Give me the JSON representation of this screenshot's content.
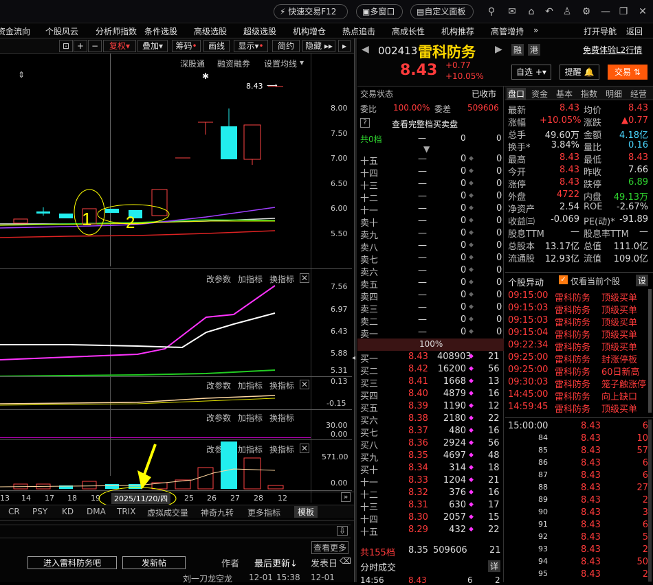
{
  "titlebar": {
    "quick_trade": "快速交易F12",
    "multi_window": "多窗口",
    "custom_panel": "自定义面板"
  },
  "menu": [
    "资金流向",
    "个股风云",
    "分析师指数",
    "条件选股",
    "高级选股",
    "超级选股",
    "机构增仓",
    "热点追击",
    "高成长性",
    "机构推荐",
    "高管增持",
    "»",
    "打开导航",
    "返回"
  ],
  "toolbar": {
    "fuquan": "复权",
    "overlay": "叠加",
    "chips": "筹码",
    "draw": "画线",
    "display": "显示",
    "simple": "简约",
    "hide": "隐藏"
  },
  "chart_top": {
    "links": [
      "深股通",
      "融资融券",
      "设置均线"
    ],
    "price_label": "8.43",
    "yaxis": [
      "8.00",
      "7.50",
      "7.00",
      "6.50",
      "6.00",
      "5.50"
    ]
  },
  "panel2": {
    "btns": [
      "改参数",
      "加指标",
      "换指标"
    ],
    "yaxis": [
      "7.56",
      "6.97",
      "6.43",
      "5.88",
      "5.31"
    ]
  },
  "panel3": {
    "btns": [
      "改参数",
      "加指标",
      "换指标"
    ],
    "yaxis": [
      "0.13",
      "-0.15"
    ]
  },
  "panel4": {
    "btns": [
      "改参数",
      "加指标",
      "换指标"
    ],
    "yaxis": [
      "30.00",
      "0.00"
    ]
  },
  "panel5": {
    "btns": [
      "改参数",
      "加指标",
      "换指标"
    ],
    "yaxis": [
      "571.00",
      "0.00"
    ]
  },
  "xaxis": [
    "13",
    "14",
    "17",
    "18",
    "19",
    "2025/11/20/四",
    "25",
    "26",
    "27",
    "28",
    "12"
  ],
  "annotations": {
    "mark1": "1",
    "mark2": "2"
  },
  "indicator_tabs": [
    "CR",
    "PSY",
    "KD",
    "DMA",
    "TRIX",
    "虚拟成交量",
    "神奇九转",
    "更多指标",
    "模板"
  ],
  "bottom": {
    "check_more": "查看更多",
    "enter_bar": "进入雷科防务吧",
    "post": "发新帖",
    "author": "作者",
    "last_update": "最后更新↓",
    "post_date": "发表日",
    "row_author": "刘一刀龙空龙",
    "row_date1": "12-01",
    "row_time": "15:38",
    "row_date2": "12-01"
  },
  "stock": {
    "code": "002413",
    "name": "雷科防务",
    "price": "8.43",
    "change": "+0.77",
    "pct": "+10.05%",
    "tag1": "融",
    "tag2": "港",
    "l2": "免费体验L2行情",
    "btn_watch": "自选",
    "btn_alert": "提醒",
    "btn_trade": "交易"
  },
  "orderbook": {
    "status_label": "交易状态",
    "status_value": "已收市",
    "weibi_label": "委比",
    "weibi_value": "100.00%",
    "weicha_label": "委差",
    "weicha_value": "509606",
    "full_label": "查看完整档买卖盘",
    "total_sell": "共0档",
    "total_sell_a": "—",
    "total_sell_b": "0",
    "total_sell_c": "0",
    "sell": [
      [
        "十五",
        "—",
        "0",
        "0"
      ],
      [
        "十四",
        "—",
        "0",
        "0"
      ],
      [
        "十三",
        "—",
        "0",
        "0"
      ],
      [
        "十二",
        "—",
        "0",
        "0"
      ],
      [
        "十一",
        "—",
        "0",
        "0"
      ],
      [
        "卖十",
        "—",
        "0",
        "0"
      ],
      [
        "卖九",
        "—",
        "0",
        "0"
      ],
      [
        "卖八",
        "—",
        "0",
        "0"
      ],
      [
        "卖七",
        "—",
        "0",
        "0"
      ],
      [
        "卖六",
        "—",
        "0",
        "0"
      ],
      [
        "卖五",
        "—",
        "0",
        "0"
      ],
      [
        "卖四",
        "—",
        "0",
        "0"
      ],
      [
        "卖三",
        "—",
        "0",
        "0"
      ],
      [
        "卖二",
        "—",
        "0",
        "0"
      ],
      [
        "卖一",
        "—",
        "0",
        "0"
      ]
    ],
    "ratio": "100%",
    "buy": [
      [
        "买一",
        "8.43",
        "408903",
        "21"
      ],
      [
        "买二",
        "8.42",
        "16200",
        "56"
      ],
      [
        "买三",
        "8.41",
        "1668",
        "13"
      ],
      [
        "买四",
        "8.40",
        "4879",
        "16"
      ],
      [
        "买五",
        "8.39",
        "1190",
        "12"
      ],
      [
        "买六",
        "8.38",
        "2180",
        "22"
      ],
      [
        "买七",
        "8.37",
        "480",
        "16"
      ],
      [
        "买八",
        "8.36",
        "2924",
        "56"
      ],
      [
        "买九",
        "8.35",
        "4697",
        "48"
      ],
      [
        "买十",
        "8.34",
        "314",
        "18"
      ],
      [
        "十一",
        "8.33",
        "1204",
        "21"
      ],
      [
        "十二",
        "8.32",
        "376",
        "16"
      ],
      [
        "十三",
        "8.31",
        "630",
        "17"
      ],
      [
        "十四",
        "8.30",
        "2057",
        "15"
      ],
      [
        "十五",
        "8.29",
        "432",
        "22"
      ]
    ],
    "total_buy": "共155档",
    "total_buy_price": "8.35",
    "total_buy_vol": "509606",
    "total_buy_cnt": "21",
    "ticks_label": "分时成交",
    "ticks_detail": "详",
    "tick_partial": [
      "14:56",
      "8.43",
      "6",
      "2"
    ]
  },
  "tabs": [
    "盘口",
    "资金",
    "基本",
    "指数",
    "明细",
    "经营"
  ],
  "quote": [
    [
      "最新",
      "8.43",
      "均价",
      "8.43"
    ],
    [
      "涨幅",
      "+10.05%",
      "涨跌",
      "▲0.77"
    ],
    [
      "总手",
      "49.60万",
      "金额",
      "4.18亿"
    ],
    [
      "换手*",
      "3.84%",
      "量比",
      "0.16"
    ],
    [
      "最高",
      "8.43",
      "最低",
      "8.43"
    ],
    [
      "今开",
      "8.43",
      "昨收",
      "7.66"
    ],
    [
      "涨停",
      "8.43",
      "跌停",
      "6.89"
    ],
    [
      "外盘",
      "4722",
      "内盘",
      "49.13万"
    ],
    [
      "净资产",
      "2.54",
      "ROE",
      "-2.67%"
    ],
    [
      "收益㈢",
      "-0.069",
      "PE(动)*",
      "-91.89"
    ],
    [
      "股息TTM",
      "—",
      "股息率TTM",
      "—"
    ],
    [
      "总股本",
      "13.17亿",
      "总值",
      "111.0亿"
    ],
    [
      "流通股",
      "12.93亿",
      "流值",
      "109.0亿"
    ]
  ],
  "alerts": {
    "title": "个股异动",
    "only_current": "仅看当前个股",
    "settings": "设",
    "rows": [
      [
        "09:15:00",
        "雷科防务",
        "顶级买单"
      ],
      [
        "09:15:03",
        "雷科防务",
        "顶级买单"
      ],
      [
        "09:15:03",
        "雷科防务",
        "顶级买单"
      ],
      [
        "09:15:04",
        "雷科防务",
        "顶级买单"
      ],
      [
        "09:22:34",
        "雷科防务",
        "顶级买单"
      ],
      [
        "09:25:00",
        "雷科防务",
        "封涨停板"
      ],
      [
        "09:25:00",
        "雷科防务",
        "60日新高"
      ],
      [
        "09:30:03",
        "雷科防务",
        "笼子触涨停"
      ],
      [
        "14:45:00",
        "雷科防务",
        "向上缺口"
      ],
      [
        "14:59:45",
        "雷科防务",
        "顶级买单"
      ]
    ]
  },
  "ticks": [
    [
      "15:00:00",
      "8.43",
      "6"
    ],
    [
      "84",
      "8.43",
      "10"
    ],
    [
      "85",
      "8.43",
      "57"
    ],
    [
      "86",
      "8.43",
      "6"
    ],
    [
      "87",
      "8.43",
      "6"
    ],
    [
      "88",
      "8.43",
      "27"
    ],
    [
      "89",
      "8.43",
      "2"
    ],
    [
      "90",
      "8.43",
      "3"
    ],
    [
      "91",
      "8.43",
      "6"
    ],
    [
      "92",
      "8.43",
      "5"
    ],
    [
      "93",
      "8.43",
      "2"
    ],
    [
      "94",
      "8.43",
      "50"
    ],
    [
      "95",
      "8.43",
      "2"
    ]
  ]
}
